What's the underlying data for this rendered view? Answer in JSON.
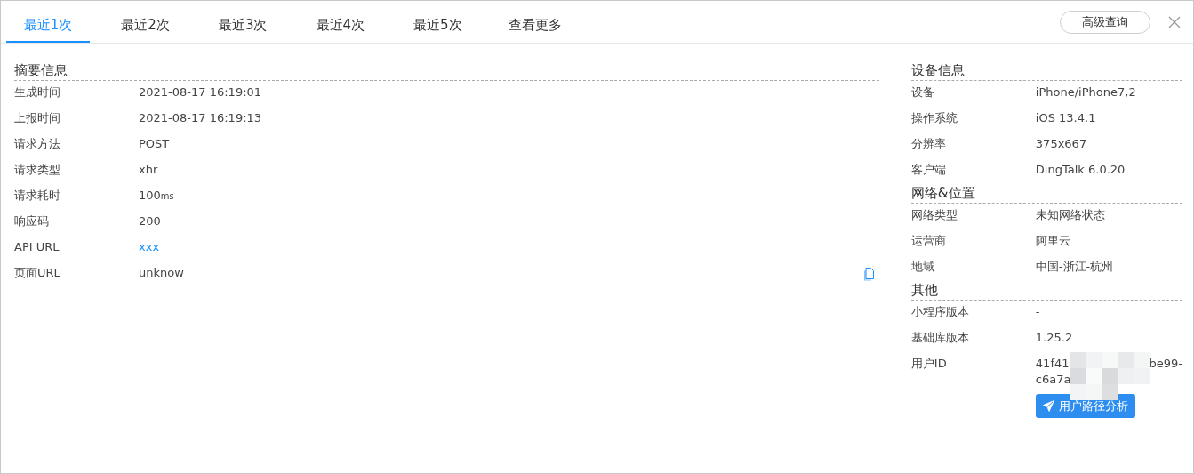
{
  "tabs": [
    {
      "label": "最近1次",
      "selected": true
    },
    {
      "label": "最近2次",
      "selected": false
    },
    {
      "label": "最近3次",
      "selected": false
    },
    {
      "label": "最近4次",
      "selected": false
    },
    {
      "label": "最近5次",
      "selected": false
    },
    {
      "label": "查看更多",
      "selected": false
    }
  ],
  "advanced_query_button": "高级查询",
  "left_sections": [
    {
      "title": "摘要信息",
      "rows": [
        {
          "label": "生成时间",
          "value": "2021-08-17 16:19:01",
          "kind": "text"
        },
        {
          "label": "上报时间",
          "value": "2021-08-17 16:19:13",
          "kind": "text"
        },
        {
          "label": "请求方法",
          "value": "POST",
          "kind": "text"
        },
        {
          "label": "请求类型",
          "value": "xhr",
          "kind": "text"
        },
        {
          "label": "请求耗时",
          "value": "100",
          "unit": "ms",
          "kind": "duration"
        },
        {
          "label": "响应码",
          "value": "200",
          "kind": "text"
        },
        {
          "label": "API URL",
          "value": "xxx",
          "kind": "link"
        },
        {
          "label": "页面URL",
          "value": "unknow",
          "kind": "copyable"
        }
      ]
    }
  ],
  "right_sections": [
    {
      "title": "设备信息",
      "rows": [
        {
          "label": "设备",
          "value": "iPhone/iPhone7,2",
          "kind": "text"
        },
        {
          "label": "操作系统",
          "value": "iOS 13.4.1",
          "kind": "text"
        },
        {
          "label": "分辨率",
          "value": "375x667",
          "kind": "text"
        },
        {
          "label": "客户端",
          "value": "DingTalk 6.0.20",
          "kind": "text"
        }
      ]
    },
    {
      "title": "网络&位置",
      "rows": [
        {
          "label": "网络类型",
          "value": "未知网络状态",
          "kind": "text"
        },
        {
          "label": "运营商",
          "value": "阿里云",
          "kind": "text"
        },
        {
          "label": "地域",
          "value": "中国-浙江-杭州",
          "kind": "text"
        }
      ]
    },
    {
      "title": "其他",
      "rows": [
        {
          "label": "小程序版本",
          "value": "-",
          "kind": "text"
        },
        {
          "label": "基础库版本",
          "value": "1.25.2",
          "kind": "text"
        },
        {
          "label": "用户ID",
          "value_parts": [
            "41f41",
            "be99-",
            "c6a7a"
          ],
          "kind": "redacted"
        }
      ]
    }
  ],
  "path_analysis_button": "用户路径分析"
}
